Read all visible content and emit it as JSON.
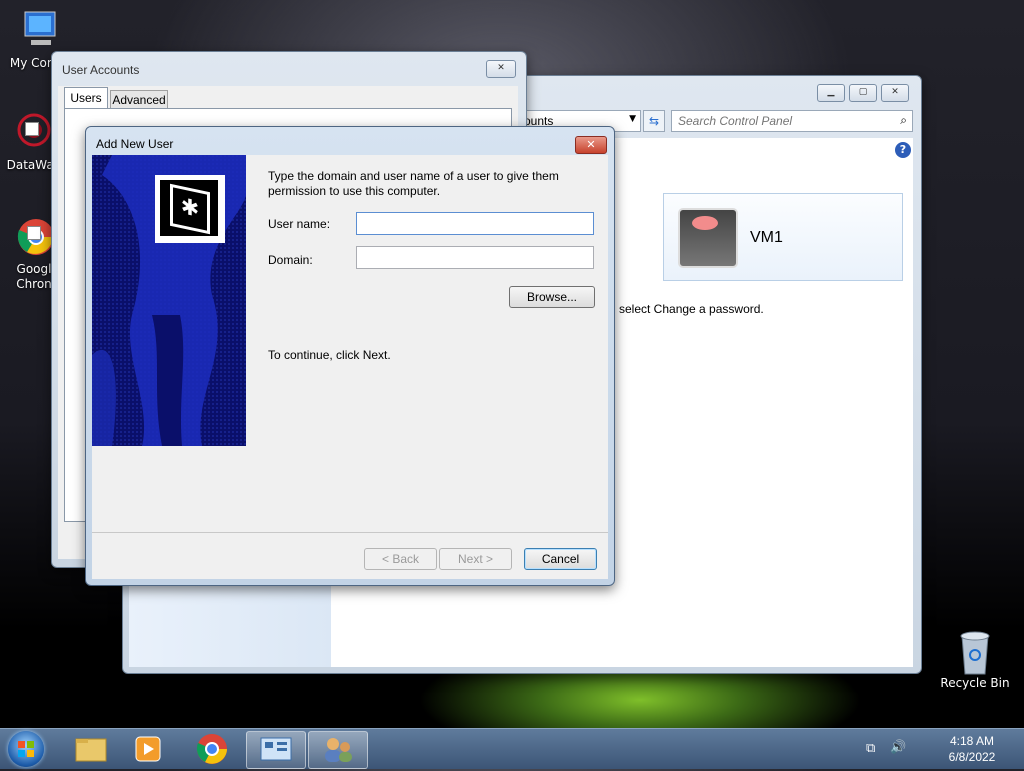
{
  "desktop": {
    "icons": [
      {
        "label": "My Comp"
      },
      {
        "label": "DataWag"
      },
      {
        "label": "Googl Chron"
      },
      {
        "label": "Recycle Bin"
      }
    ]
  },
  "control_panel": {
    "breadcrumb_fragment": "ounts",
    "search_placeholder": "Search Control Panel",
    "account_name": "VM1",
    "hint_text": "select Change a password."
  },
  "user_accounts": {
    "title": "User Accounts",
    "tabs": [
      {
        "label": "Users"
      },
      {
        "label": "Advanced"
      }
    ]
  },
  "dialog": {
    "title": "Add New User",
    "intro": "Type the domain and user name of a user to give them permission to use this computer.",
    "username_label": "User name:",
    "username_value": "",
    "domain_label": "Domain:",
    "domain_value": "",
    "browse_label": "Browse...",
    "continue_text": "To continue, click Next.",
    "back_label": "< Back",
    "next_label": "Next >",
    "cancel_label": "Cancel"
  },
  "taskbar": {
    "time": "4:18 AM",
    "date": "6/8/2022",
    "pinned": [
      "start-orb",
      "explorer",
      "media-player",
      "chrome",
      "control-panel",
      "user-accounts"
    ]
  }
}
